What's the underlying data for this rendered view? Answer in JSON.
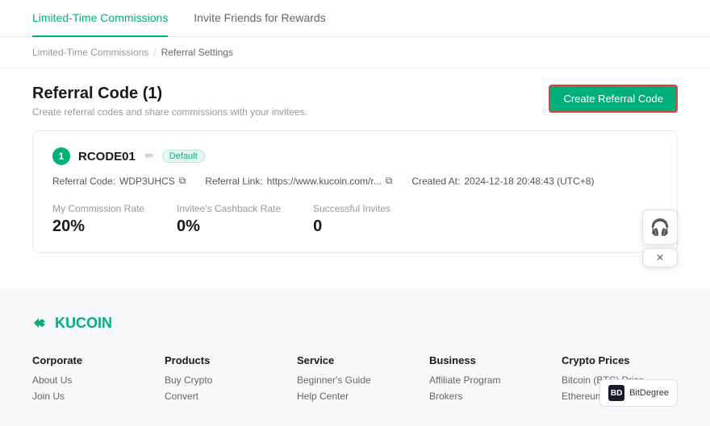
{
  "tabs": [
    {
      "id": "limited-time",
      "label": "Limited-Time Commissions",
      "active": true
    },
    {
      "id": "invite-friends",
      "label": "Invite Friends for Rewards",
      "active": false
    }
  ],
  "breadcrumb": {
    "parent": "Limited-Time Commissions",
    "separator": "/",
    "current": "Referral Settings"
  },
  "page": {
    "title": "Referral Code (1)",
    "subtitle": "Create referral codes and share commissions with your invitees.",
    "create_button_label": "Create Referral Code"
  },
  "referral_card": {
    "number": "1",
    "code_name": "RCODE01",
    "badge": "Default",
    "referral_code_label": "Referral Code:",
    "referral_code_value": "WDP3UHCS",
    "referral_link_label": "Referral Link:",
    "referral_link_value": "https://www.kucoin.com/r...",
    "created_at_label": "Created At:",
    "created_at_value": "2024-12-18 20:48:43 (UTC+8)",
    "stats": [
      {
        "label": "My Commission Rate",
        "value": "20%"
      },
      {
        "label": "Invitee's Cashback Rate",
        "value": "0%"
      },
      {
        "label": "Successful Invites",
        "value": "0"
      }
    ]
  },
  "support": {
    "icon": "🎧",
    "close": "✕"
  },
  "footer": {
    "logo_text": "KUCOIN",
    "columns": [
      {
        "title": "Corporate",
        "links": [
          "About Us",
          "Join Us"
        ]
      },
      {
        "title": "Products",
        "links": [
          "Buy Crypto",
          "Convert"
        ]
      },
      {
        "title": "Service",
        "links": [
          "Beginner's Guide",
          "Help Center"
        ]
      },
      {
        "title": "Business",
        "links": [
          "Affiliate Program",
          "Brokers"
        ]
      },
      {
        "title": "Crypto Prices",
        "links": [
          "Bitcoin (BTC) Price",
          "Ethereum (ETH) Price"
        ]
      }
    ],
    "bitdegree_label": "BitDegree"
  }
}
